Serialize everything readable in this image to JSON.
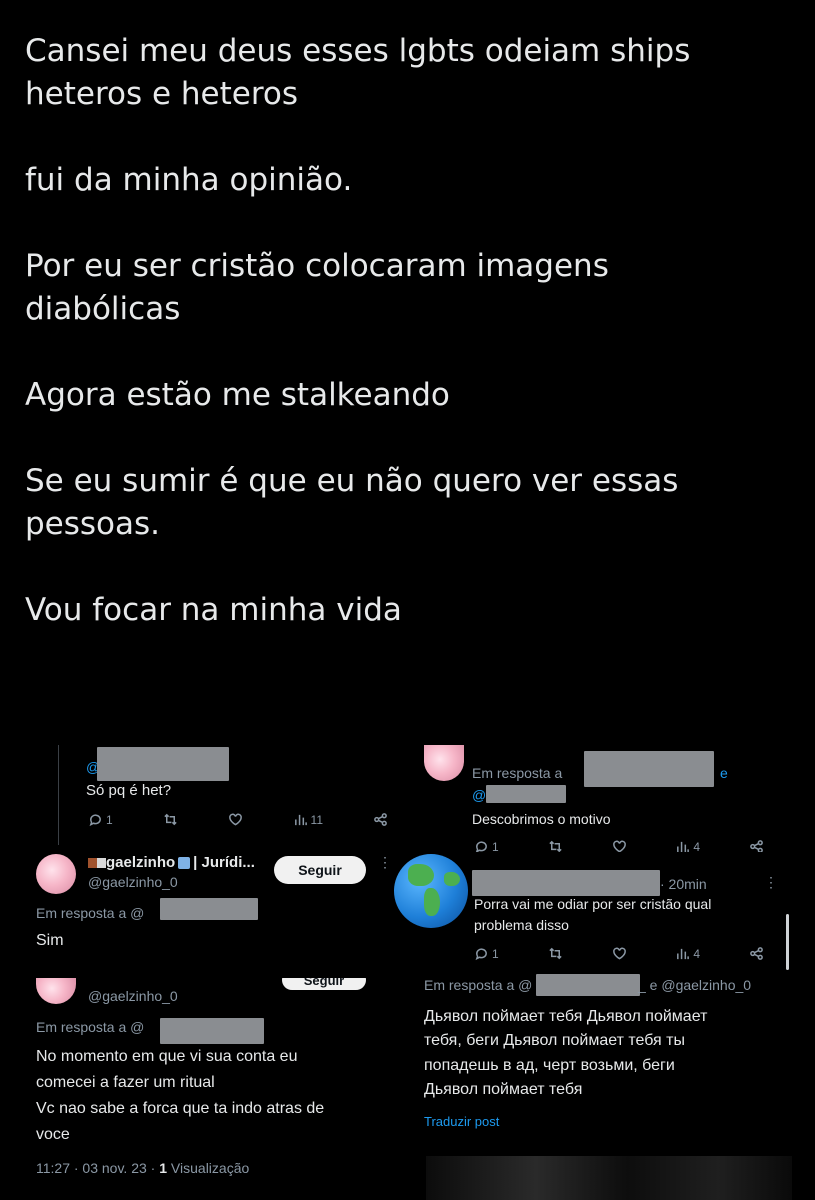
{
  "post": {
    "p1": "Cansei meu deus esses lgbts odeiam ships heteros e heteros",
    "p2": "fui da minha opinião.",
    "p3": "Por eu ser cristão colocaram imagens diabólicas",
    "p4": "Agora estão me stalkeando",
    "p5": "Se eu sumir é que eu não quero ver essas pessoas.",
    "p6": "Vou focar na minha vida"
  },
  "tl": {
    "at": "@",
    "text": "Só pq é het?",
    "replies": "1",
    "views": "11"
  },
  "ml": {
    "name": "gaelzinho",
    "name_suffix": "| Jurídi...",
    "handle": "@gaelzinho_0",
    "follow": "Seguir",
    "reply_to": "Em resposta a @",
    "text": "Sim"
  },
  "bl": {
    "handle": "@gaelzinho_0",
    "follow": "Seguir",
    "reply_to": "Em resposta a @",
    "line1": "No momento em que vi sua conta eu",
    "line2": "comecei a fazer um ritual",
    "line3": "Vc nao sabe a forca que ta indo atras de",
    "line4": "voce",
    "time": "11:27 · 03 nov. 23 ·",
    "views_count": "1",
    "views_label": "Visualização"
  },
  "tr": {
    "reply_to": "Em resposta a",
    "and": "e",
    "at": "@",
    "text": "Descobrimos o motivo",
    "replies": "1",
    "views": "4"
  },
  "mr": {
    "time": "· 20min",
    "line1": "Porra vai me odiar por ser cristão qual",
    "line2": "problema disso",
    "replies": "1",
    "views": "4"
  },
  "br": {
    "reply_to": "Em resposta a @",
    "and_handle": "_ e @gaelzinho_0",
    "line1": "Дьявол поймает тебя Дьявол поймает",
    "line2": "тебя, беги Дьявол поймает тебя ты",
    "line3": "попадешь в ад, черт возьми, беги",
    "line4": "Дьявол поймает тебя",
    "translate": "Traduzir post"
  },
  "colors": {
    "bg": "#000000",
    "text": "#e7e9ea",
    "muted": "#8b98a5",
    "link": "#1d9bf0"
  }
}
